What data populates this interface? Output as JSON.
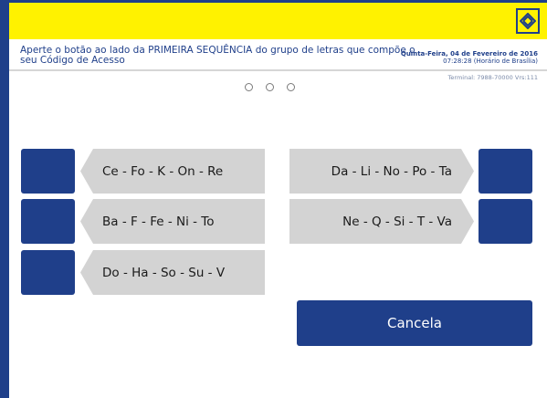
{
  "header": {
    "instruction": "Aperte o botão ao lado da  PRIMEIRA SEQUÊNCIA do grupo de letras que compõe o seu Código de Acesso",
    "date_line1": "Quinta-Feira, 04 de Fevereiro de 2016",
    "date_line2": "07:28:28 (Horário de Brasília)",
    "terminal": "Terminal: 7988-70000 Vrs:111"
  },
  "progress": {
    "total_steps": 3,
    "completed_steps": 0
  },
  "options_left": [
    "Ce - Fo - K - On - Re",
    "Ba - F - Fe - Ni - To",
    "Do - Ha - So - Su - V"
  ],
  "options_right": [
    "Da - Li - No - Po - Ta",
    "Ne - Q - Si - T - Va"
  ],
  "buttons": {
    "cancel_label": "Cancela"
  },
  "colors": {
    "accent_blue": "#1f3f8a",
    "header_yellow": "#fff200",
    "option_gray": "#d3d3d3"
  },
  "icons": {
    "logo": "banco-do-brasil-logo-icon"
  }
}
